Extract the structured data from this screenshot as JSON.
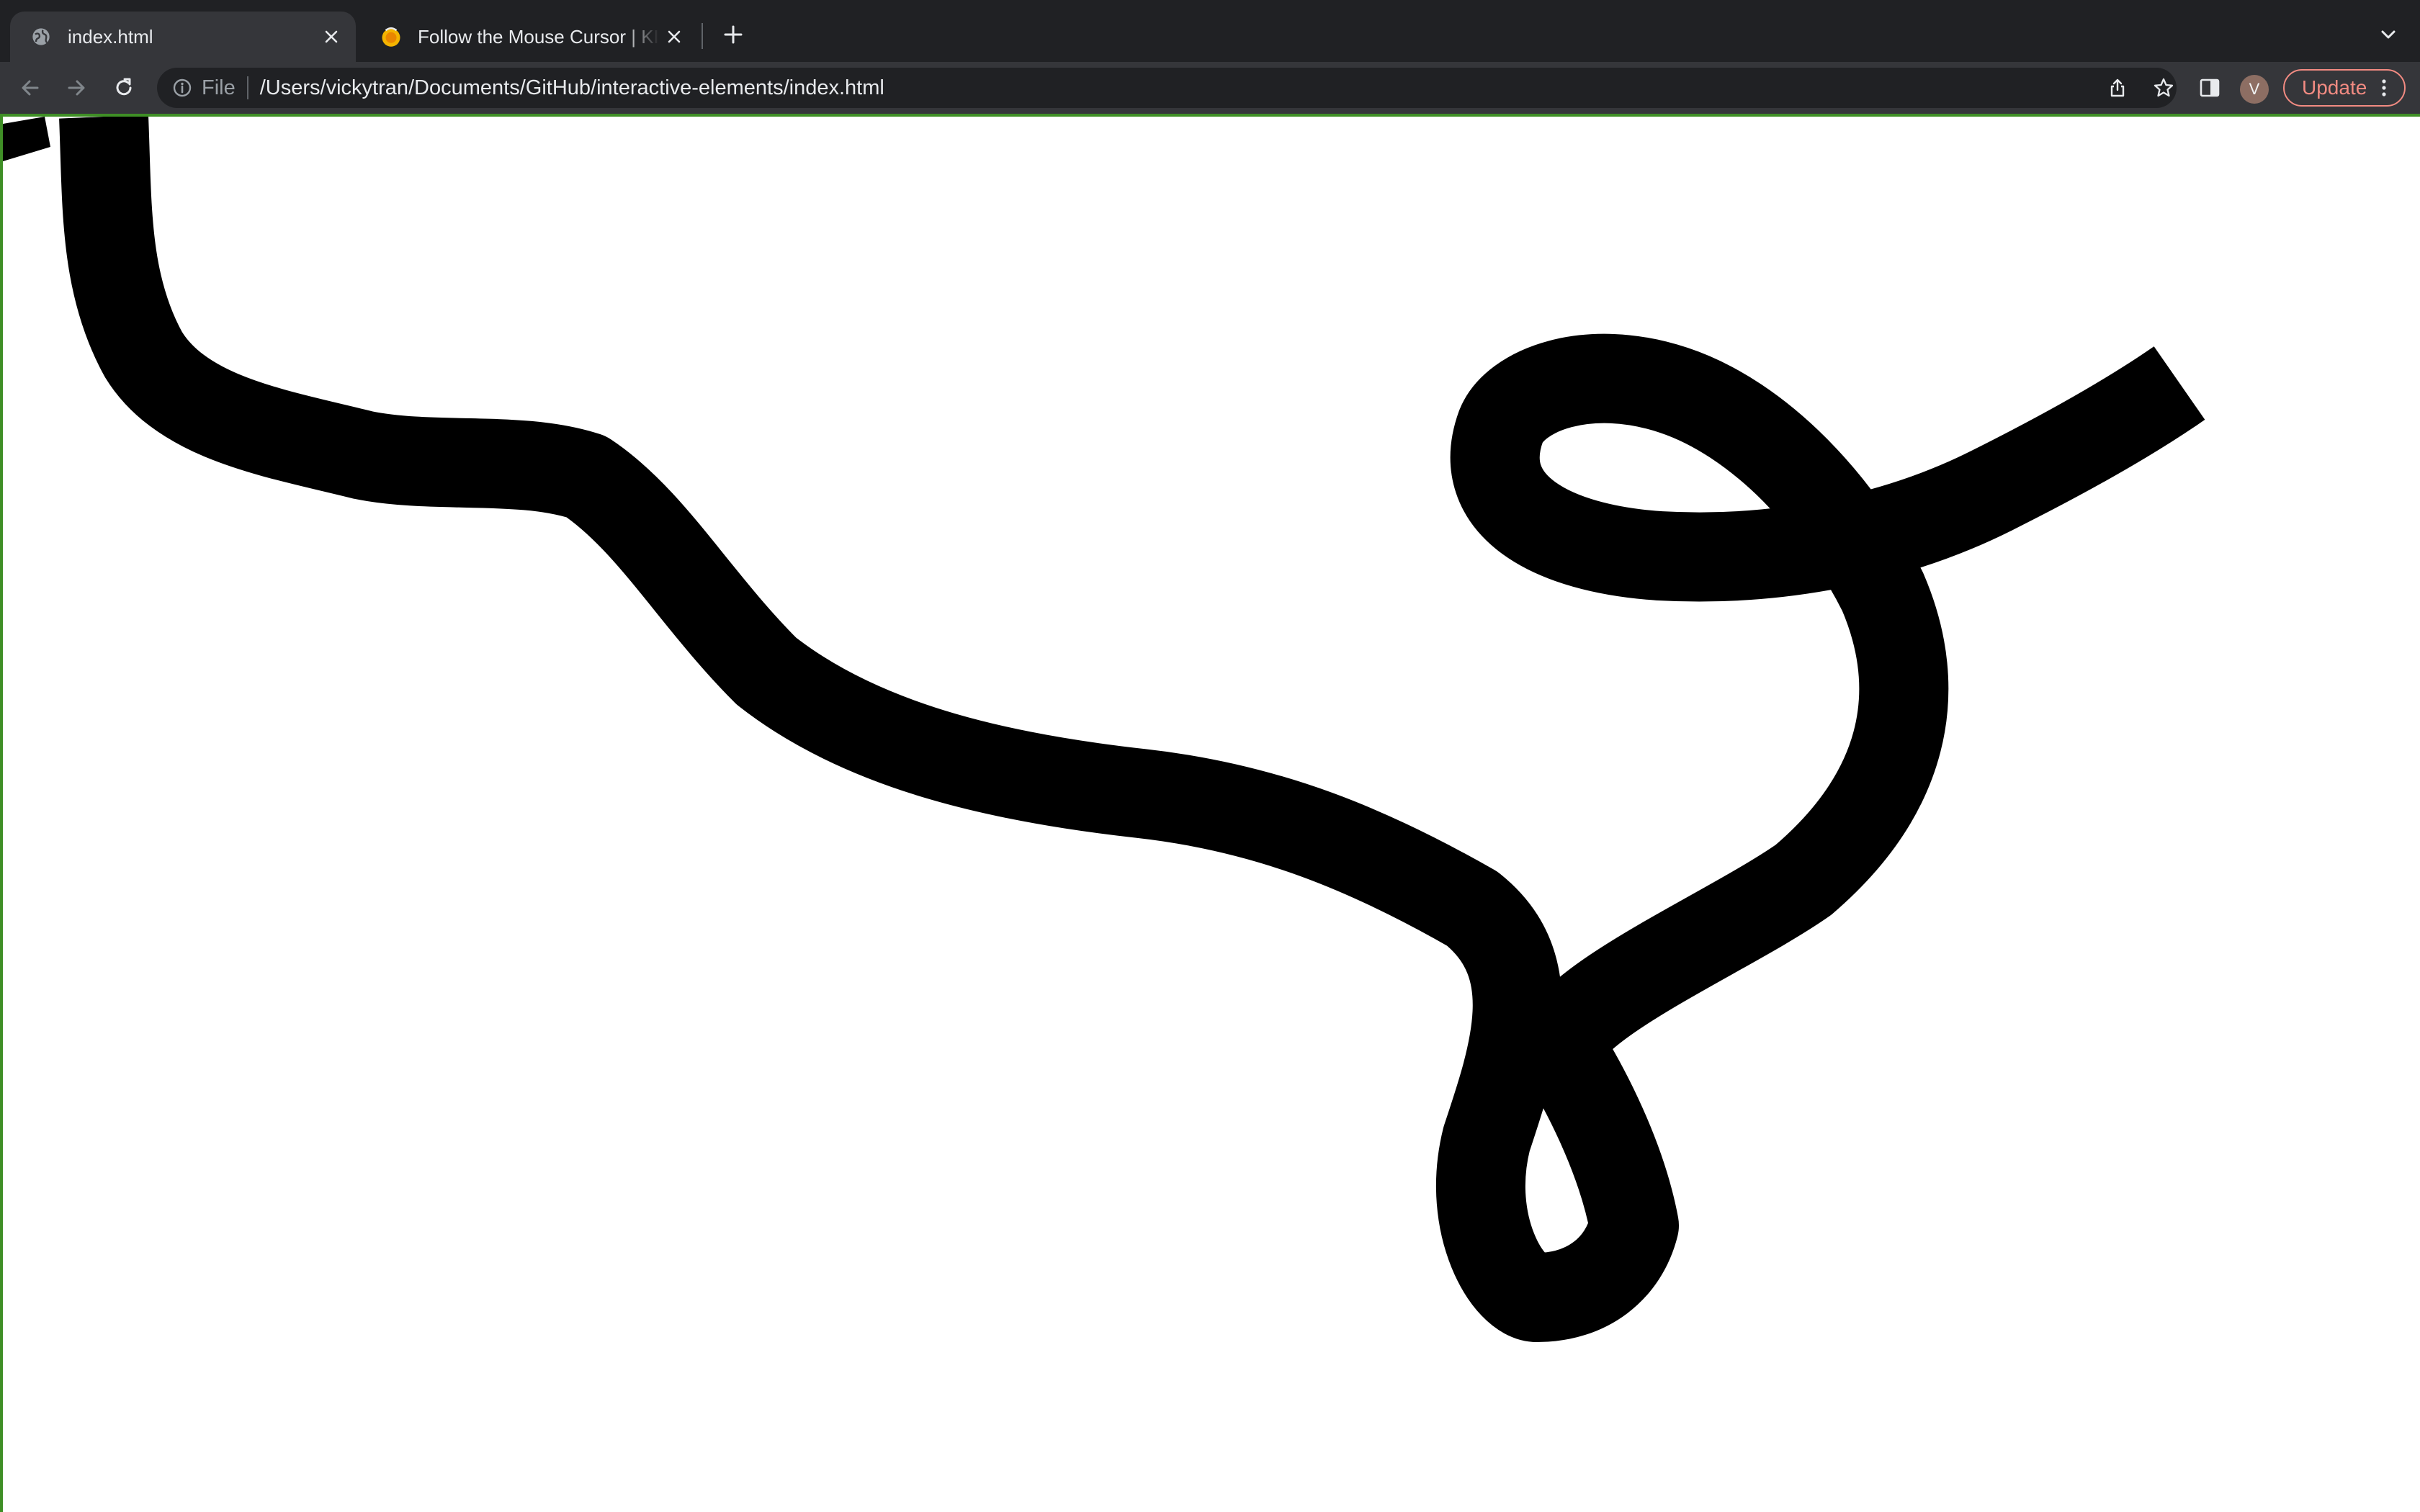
{
  "browser": {
    "tabs": [
      {
        "title": "index.html",
        "favicon": "globe-icon",
        "active": true
      },
      {
        "title": "Follow the Mouse Cursor | KIRUPA",
        "favicon": "kirupa-favicon-icon",
        "active": false
      }
    ],
    "omnibox": {
      "scheme": "File",
      "url": "/Users/vickytran/Documents/GitHub/interactive-elements/index.html"
    },
    "profile_initial": "V",
    "update_label": "Update"
  },
  "colors": {
    "tab_strip": "#202124",
    "toolbar": "#35363a",
    "update_accent": "#f28b82",
    "page_border": "#3f8f26",
    "page_background": "#ffffff",
    "stroke": "#000000"
  },
  "drawing": {
    "description_visible": false
  }
}
